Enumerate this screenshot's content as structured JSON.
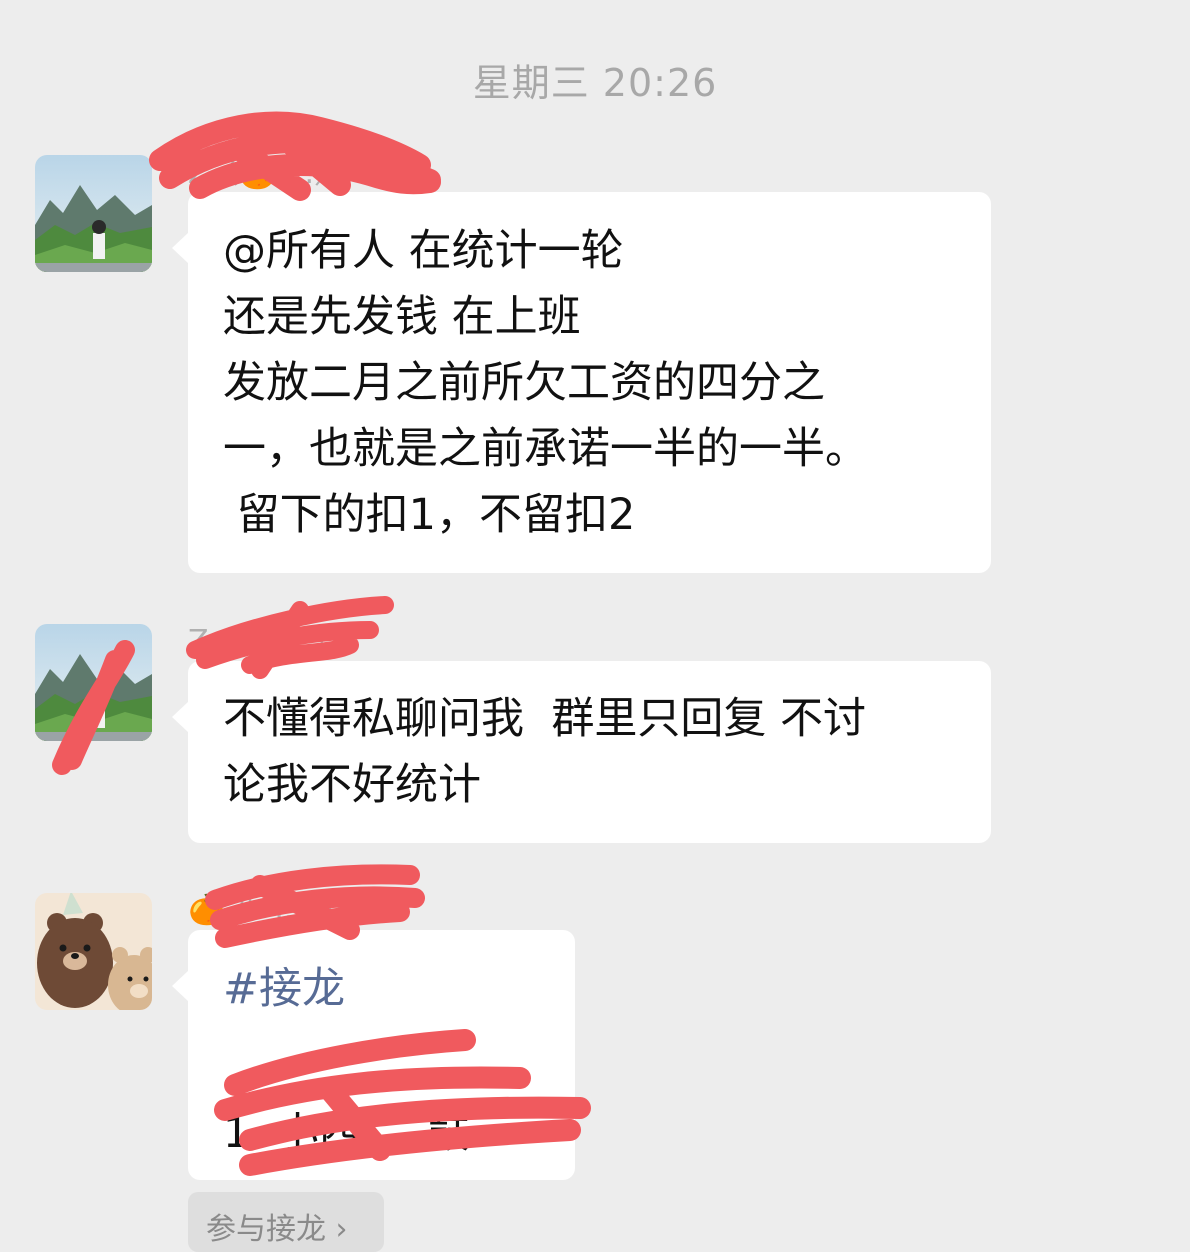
{
  "chat": {
    "timestamp": "星期三 20:26",
    "messages": [
      {
        "sender": "Z（🍊 ...）",
        "lines": [
          "@所有人 在统计一轮",
          "还是先发钱 在上班",
          "发放二月之前所欠工资的四分之",
          "一，也就是之前承诺一半的一半。",
          " 留下的扣1，不留扣2"
        ]
      },
      {
        "sender": "Z（🍊 ...）",
        "lines": [
          "不懂得私聊问我  群里只回复 不讨",
          "论我不好统计"
        ]
      },
      {
        "sender": "🍊 小 ... 鼓",
        "hashtag": "#接龙",
        "list_item": "1. 小西 ... 鼓"
      }
    ],
    "join_button": "参与接龙 ›"
  },
  "colors": {
    "background": "#ededed",
    "bubble": "#ffffff",
    "hashtag": "#576b95",
    "redaction": "#f05a5e"
  }
}
